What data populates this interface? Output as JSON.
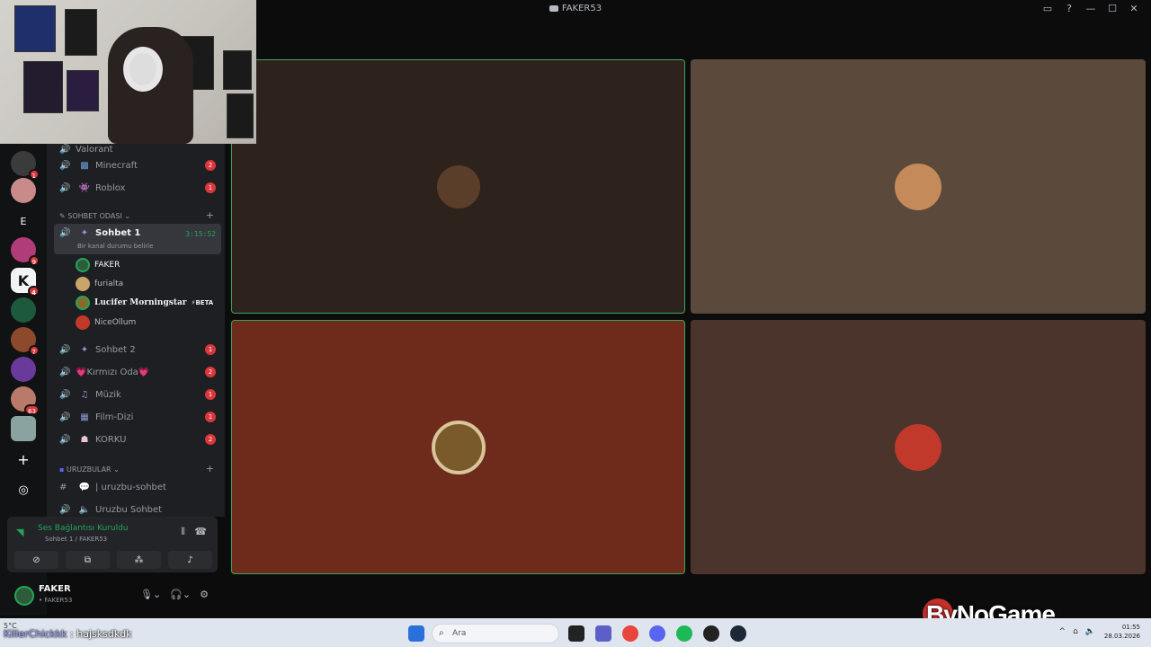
{
  "window": {
    "title": "FAKER53"
  },
  "channels": {
    "partial_top": "Valorant",
    "voice": [
      {
        "name": "Minecraft",
        "icon": "▩",
        "badge": "2"
      },
      {
        "name": "Roblox",
        "icon": "👾",
        "badge": "1"
      }
    ],
    "category_chat": "SOHBET ODASI",
    "active": {
      "name": "Sohbet 1",
      "timer": "3:15:52",
      "status": "Bir kanal durumu belirle"
    },
    "members": [
      {
        "name": "FAKER"
      },
      {
        "name": "furialta"
      },
      {
        "name": "Lucifer Morningstar",
        "tag": "⚡BETA"
      },
      {
        "name": "NiceOllum"
      }
    ],
    "voice2": [
      {
        "name": "Sohbet 2",
        "badge": "1"
      },
      {
        "name": "💗Kırmızı Oda💗",
        "badge": "2"
      },
      {
        "name": "Müzik",
        "badge": "1"
      },
      {
        "name": "Film-Dizi",
        "badge": "1"
      },
      {
        "name": "KORKU",
        "badge": "2"
      }
    ],
    "category_uruz": "URUZBULAR",
    "text_channel": "| uruzbu-sohbet",
    "voice_uruz": "Uruzbu Sohbet"
  },
  "server_rail": {
    "servers": [
      {
        "label": "",
        "badge": "1",
        "color": "#3b3b3b"
      },
      {
        "label": "",
        "badge": "",
        "color": "#c98a8a"
      },
      {
        "label": "E",
        "badge": "",
        "color": "#111214"
      },
      {
        "label": "",
        "badge": "9",
        "color": "#b13c7a"
      },
      {
        "label": "K",
        "badge": "4",
        "color": "#f2f3f5"
      },
      {
        "label": "",
        "badge": "",
        "color": "#1d5a3b"
      },
      {
        "label": "",
        "badge": "7",
        "color": "#8b4a2b"
      },
      {
        "label": "",
        "badge": "",
        "color": "#6a3a9a"
      },
      {
        "label": "",
        "badge": "63",
        "color": "#b97a6a"
      },
      {
        "label": "",
        "badge": "",
        "color": "#8aa3a0"
      }
    ]
  },
  "voice_status": {
    "title": "Ses Bağlantısı Kuruldu",
    "subtitle": "Sohbet 1 / FAKER53"
  },
  "user": {
    "name": "FAKER",
    "status": "• FAKER53"
  },
  "watermark": "ByNoGame",
  "taskbar": {
    "chat_user": "KillerChickkk",
    "chat_msg": " : hajsksdkdk",
    "search_placeholder": "Ara",
    "time": "01:55",
    "date": "28.03.2026",
    "temp": "5°C"
  },
  "colors": {
    "speaking_green": "#3ba55c",
    "badge_red": "#da373c"
  }
}
